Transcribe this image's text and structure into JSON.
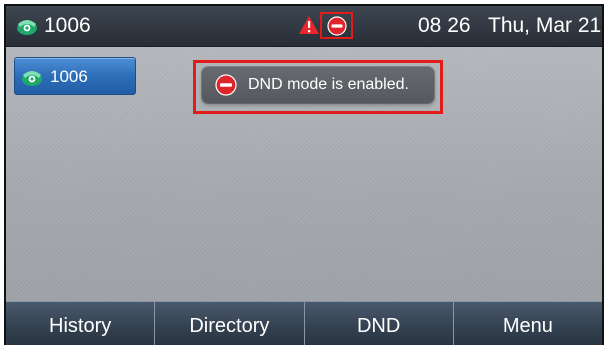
{
  "status_bar": {
    "account": "1006",
    "time": "08 26",
    "date": "Thu, Mar 21",
    "icons": [
      "phone-icon",
      "warning-icon",
      "dnd-icon"
    ]
  },
  "line_key": {
    "label": "1006",
    "icon": "phone-icon"
  },
  "popup": {
    "icon": "dnd-icon",
    "message": "DND mode is enabled."
  },
  "softkeys": [
    {
      "label": "History"
    },
    {
      "label": "Directory"
    },
    {
      "label": "DND"
    },
    {
      "label": "Menu"
    }
  ],
  "colors": {
    "highlight": "#e21b1b",
    "line_key": "#2d6eb9",
    "phone_icon": "#1fa86a",
    "dnd_icon": "#e0252a"
  }
}
